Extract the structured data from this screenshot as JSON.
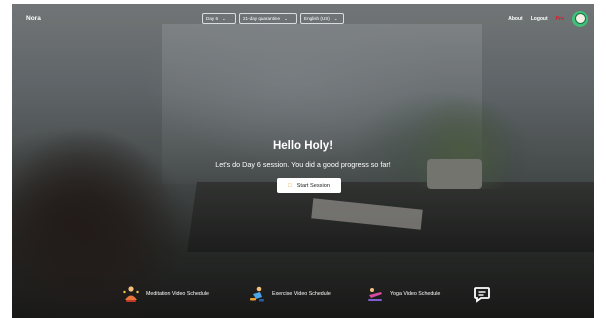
{
  "header": {
    "brand": "Nora",
    "day_select": "Day 6",
    "program_select": "21-day quarantine",
    "language_select": "English (US)",
    "nav_about": "About",
    "nav_logout": "Logout",
    "nav_pro": "Pro"
  },
  "hero": {
    "title": "Hello Holy!",
    "subtitle": "Let's do Day 6 session. You did a good progress so far!",
    "start_label": "Start Session"
  },
  "bottom": {
    "meditation": "Meditation Video Schedule",
    "exercise": "Exercise Video Schedule",
    "yoga": "Yoga Video Schedule"
  },
  "colors": {
    "accent_pro": "#e01a2a",
    "avatar": "#3fbf78",
    "start_icon": "#f0a030"
  },
  "icons": [
    "chevron-down-icon",
    "message-icon",
    "meditation-icon",
    "exercise-icon",
    "yoga-icon",
    "chat-icon"
  ]
}
